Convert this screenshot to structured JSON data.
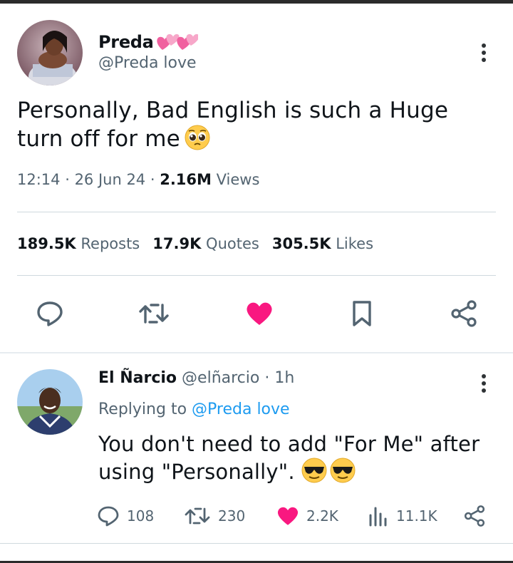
{
  "tweet": {
    "author_name": "Preda",
    "author_handle": "@Preda love",
    "text": "Personally, Bad English is such a Huge turn off for me",
    "time": "12:14",
    "date": "26 Jun 24",
    "views_count": "2.16M",
    "views_label": "Views",
    "reposts_count": "189.5K",
    "reposts_label": "Reposts",
    "quotes_count": "17.9K",
    "quotes_label": "Quotes",
    "likes_count": "305.5K",
    "likes_label": "Likes",
    "icons": [
      "reply-icon",
      "repost-icon",
      "like-icon",
      "bookmark-icon",
      "share-icon"
    ]
  },
  "reply": {
    "author_name": "El Ñarcio",
    "author_handle": "@elñarcio",
    "time": "1h",
    "replying_label": "Replying to",
    "replying_handle": "@Preda love",
    "text": "You don't need to add \"For Me\" after using \"Personally\".",
    "reply_count": "108",
    "repost_count": "230",
    "like_count": "2.2K",
    "views_count": "11.1K"
  },
  "colors": {
    "like": "#f91880",
    "link": "#1d9bf0",
    "muted": "#536471",
    "text": "#0f1419"
  }
}
